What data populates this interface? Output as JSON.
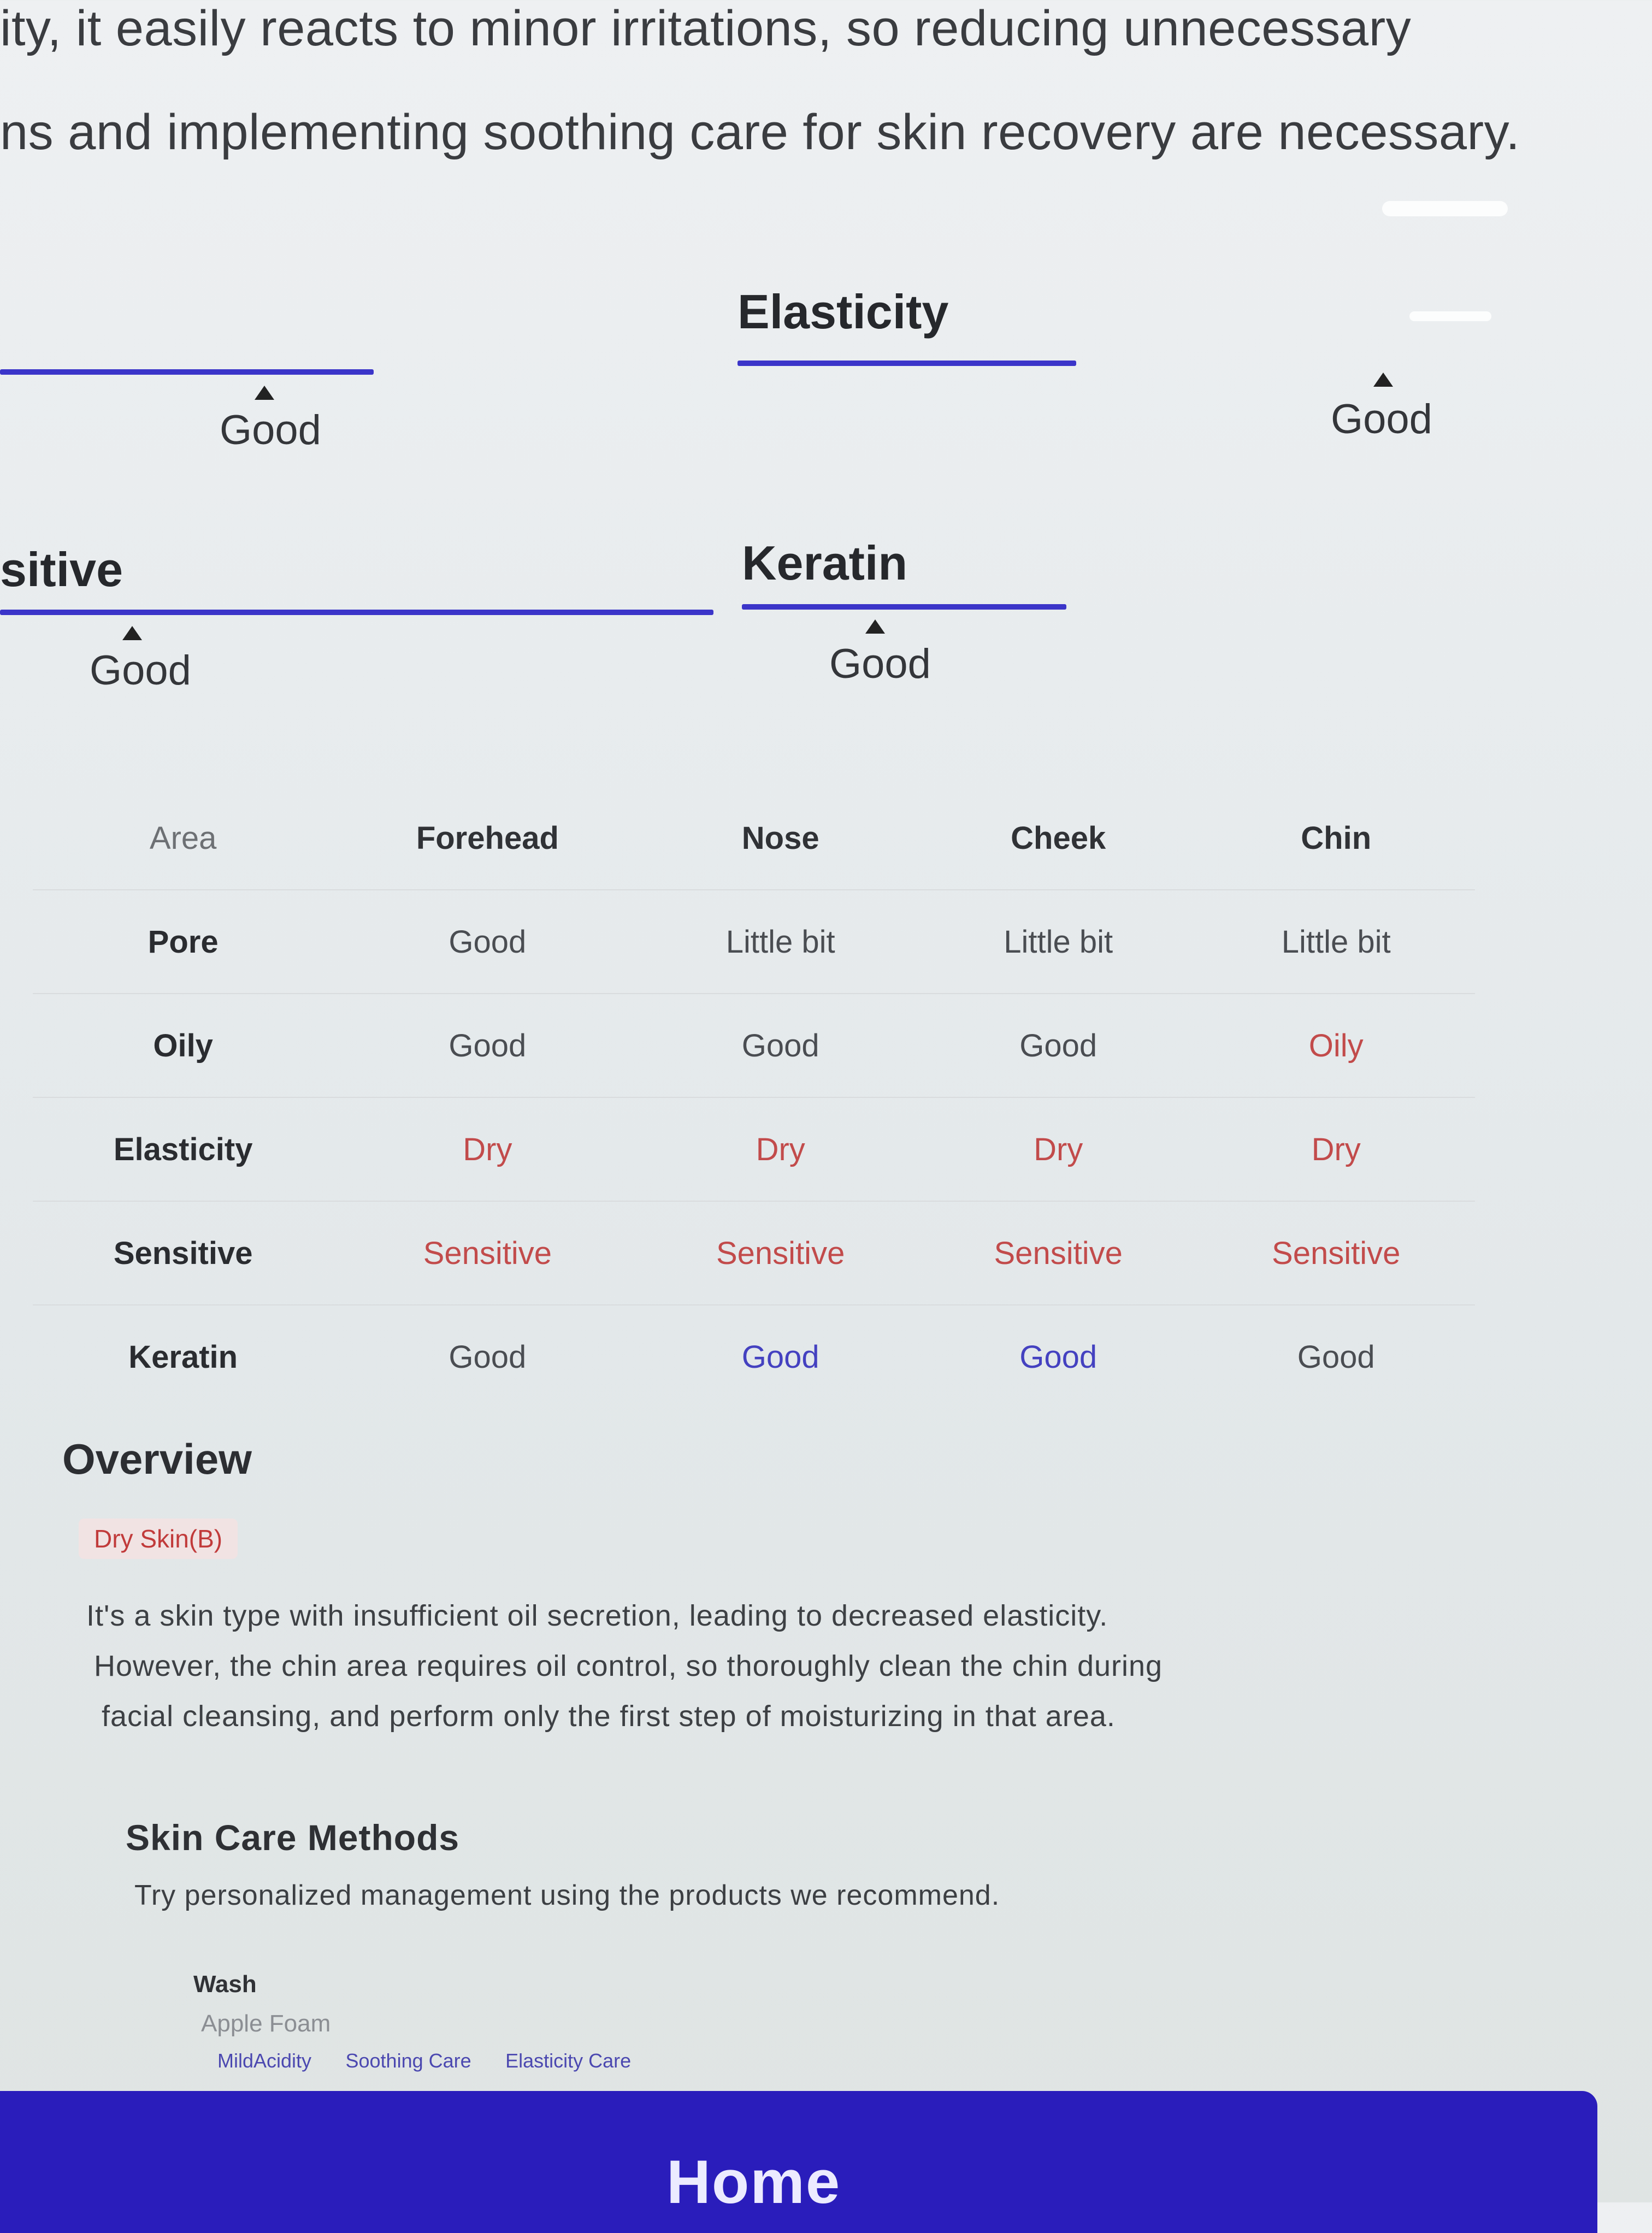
{
  "intro": {
    "line1": "ity, it easily reacts to minor irritations, so reducing unnecessary",
    "line2": "ns and implementing soothing care for skin recovery are necessary."
  },
  "metrics": {
    "elasticity": {
      "title": "Elasticity",
      "grade": "Good"
    },
    "top_left": {
      "grade": "Good"
    },
    "sensitive": {
      "title": "sitive",
      "grade": "Good"
    },
    "keratin": {
      "title": "Keratin",
      "grade": "Good"
    }
  },
  "table": {
    "headers": [
      "Area",
      "Forehead",
      "Nose",
      "Cheek",
      "Chin"
    ],
    "rows": [
      {
        "label": "Pore",
        "values": [
          "Good",
          "Little bit",
          "Little bit",
          "Little bit"
        ]
      },
      {
        "label": "Oily",
        "values": [
          "Good",
          "Good",
          "Good",
          "Oily"
        ]
      },
      {
        "label": "Elasticity",
        "values": [
          "Dry",
          "Dry",
          "Dry",
          "Dry"
        ]
      },
      {
        "label": "Sensitive",
        "values": [
          "Sensitive",
          "Sensitive",
          "Sensitive",
          "Sensitive"
        ]
      },
      {
        "label": "Keratin",
        "values": [
          "Good",
          "Good",
          "Good",
          "Good"
        ]
      }
    ]
  },
  "overview": {
    "title": "Overview",
    "badge": "Dry Skin(B)",
    "line1": "It's a skin type with insufficient oil secretion, leading to decreased elasticity.",
    "line2": "However, the chin area requires oil control, so thoroughly clean the chin during",
    "line3": "facial cleansing, and perform only the first step of moisturizing in that area."
  },
  "care": {
    "title": "Skin Care Methods",
    "subtitle": "Try personalized management using the products we recommend.",
    "wash": {
      "title": "Wash",
      "product": "Apple Foam",
      "tags": [
        "MildAcidity",
        "Soothing Care",
        "Elasticity Care"
      ]
    }
  },
  "home_button": {
    "label": "Home"
  },
  "colors": {
    "accent": "#3b35c9",
    "button": "#2a1dbb",
    "warning_text": "#c24b4b",
    "good_blue_text": "#4441c0"
  }
}
